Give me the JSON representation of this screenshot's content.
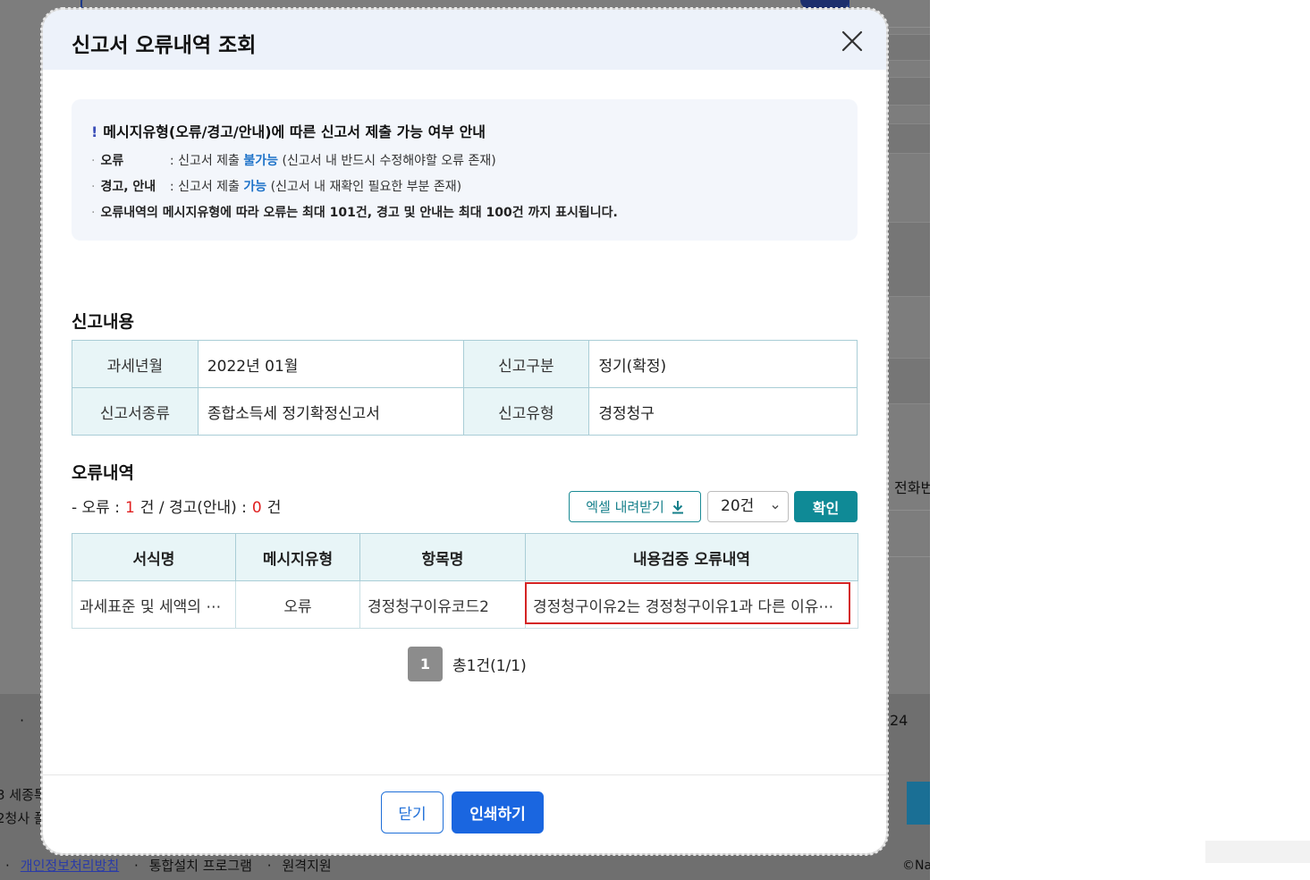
{
  "background": {
    "phone_label": "전화번",
    "number_fragment": "24",
    "address_line1": "3 세종특",
    "address_line2": "2청사 플",
    "footer_links": [
      "개인정보처리방침",
      "통합설치 프로그램",
      "원격지원"
    ],
    "copyright_fragment": "©Na"
  },
  "modal": {
    "title": "신고서 오류내역 조회",
    "notice": {
      "heading": "메시지유형(오류/경고/안내)에 따른 신고서 제출 가능 여부 안내",
      "line1": {
        "label": "오류",
        "prefix": ": 신고서 제출",
        "status": "불가능",
        "suffix": "(신고서 내 반드시 수정해야할 오류 존재)"
      },
      "line2": {
        "label": "경고, 안내",
        "prefix": ": 신고서 제출",
        "status": "가능",
        "suffix": "(신고서 내 재확인 필요한 부분 존재)"
      },
      "line3": "오류내역의 메시지유형에 따라 오류는 최대 101건, 경고 및 안내는 최대 100건 까지 표시됩니다."
    },
    "report_section_title": "신고내용",
    "report": {
      "tax_period_label": "과세년월",
      "tax_period_value": "2022년 01월",
      "report_category_label": "신고구분",
      "report_category_value": "정기(확정)",
      "form_type_label": "신고서종류",
      "form_type_value": "종합소득세 정기확정신고서",
      "report_type_label": "신고유형",
      "report_type_value": "경정청구"
    },
    "errors_section_title": "오류내역",
    "counts": {
      "error_label": "- 오류 :",
      "error_count": "1",
      "error_unit": "건 / 경고(안내) :",
      "warning_count": "0",
      "warning_unit": "건"
    },
    "toolbar": {
      "excel_label": "엑셀 내려받기",
      "page_size": "20건",
      "confirm_label": "확인"
    },
    "table": {
      "headers": [
        "서식명",
        "메시지유형",
        "항목명",
        "내용검증 오류내역"
      ],
      "rows": [
        [
          "과세표준 및 세액의 ⋯",
          "오류",
          "경정청구이유코드2",
          "경정청구이유2는 경정청구이유1과 다른 이유⋯"
        ]
      ]
    },
    "pagination": {
      "current": "1",
      "total": "총1건(1/1)"
    },
    "footer": {
      "close_label": "닫기",
      "print_label": "인쇄하기"
    }
  }
}
